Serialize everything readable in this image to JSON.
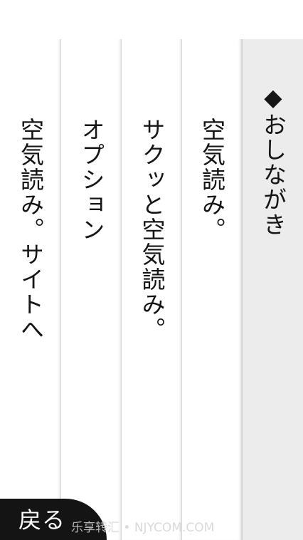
{
  "menu": {
    "header": "◆おしながき",
    "items": [
      {
        "label": "空気読み。"
      },
      {
        "label": "サクッと空気読み。"
      },
      {
        "label": "オプション"
      },
      {
        "label": "空気読み。サイトへ"
      }
    ]
  },
  "back_button": {
    "label": "戻る"
  },
  "watermark": "乐享转汇 • NJYCOM.COM",
  "colors": {
    "background": "#ffffff",
    "header_column": "#ececec",
    "text": "#151515",
    "back_button": "#141414"
  }
}
